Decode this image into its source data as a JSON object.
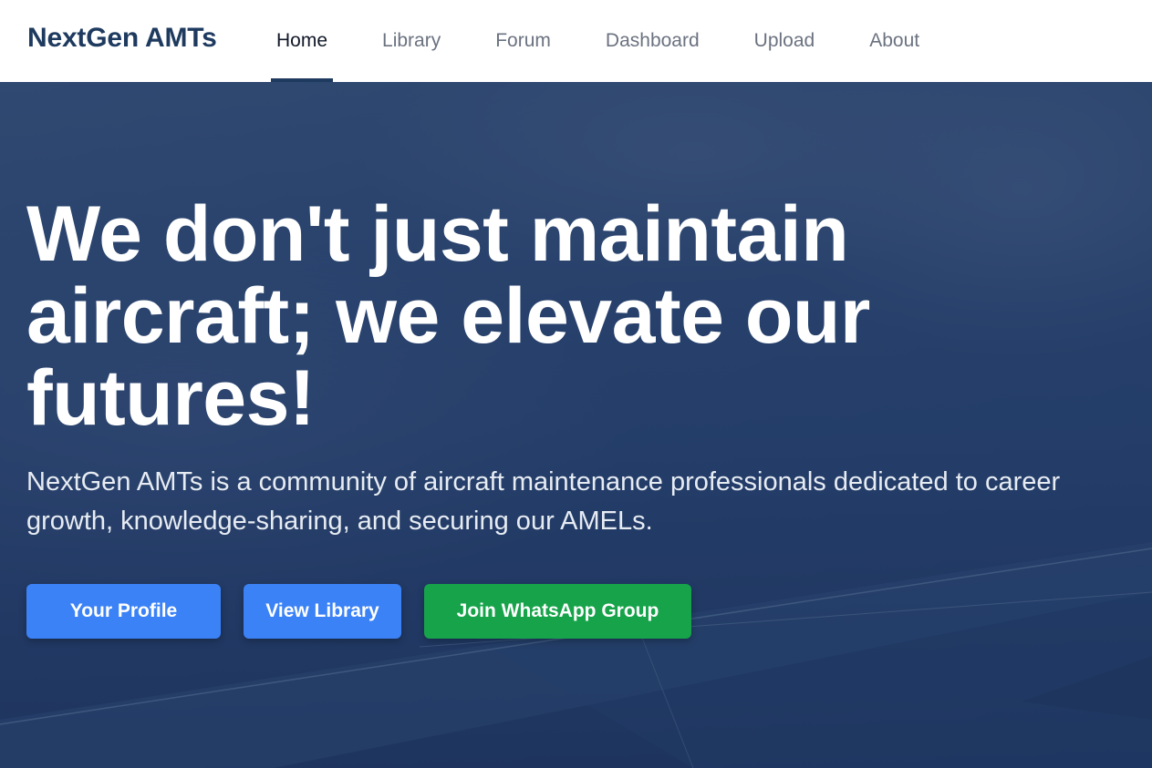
{
  "brand": {
    "name": "NextGen AMTs"
  },
  "nav": {
    "items": [
      {
        "label": "Home",
        "active": true
      },
      {
        "label": "Library",
        "active": false
      },
      {
        "label": "Forum",
        "active": false
      },
      {
        "label": "Dashboard",
        "active": false
      },
      {
        "label": "Upload",
        "active": false
      },
      {
        "label": "About",
        "active": false
      }
    ]
  },
  "hero": {
    "headline": "We don't just maintain aircraft; we elevate our futures!",
    "description": "NextGen AMTs is a community of aircraft maintenance professionals dedicated to career growth, knowledge-sharing, and securing our AMELs.",
    "buttons": {
      "profile": "Your Profile",
      "library": "View Library",
      "whatsapp": "Join WhatsApp Group"
    },
    "background_image": "sky-and-aircraft-wing"
  },
  "colors": {
    "brand": "#1e3a5f",
    "primary_button": "#3b82f6",
    "whatsapp_button": "#16a34a",
    "hero_overlay": "#21406b"
  }
}
